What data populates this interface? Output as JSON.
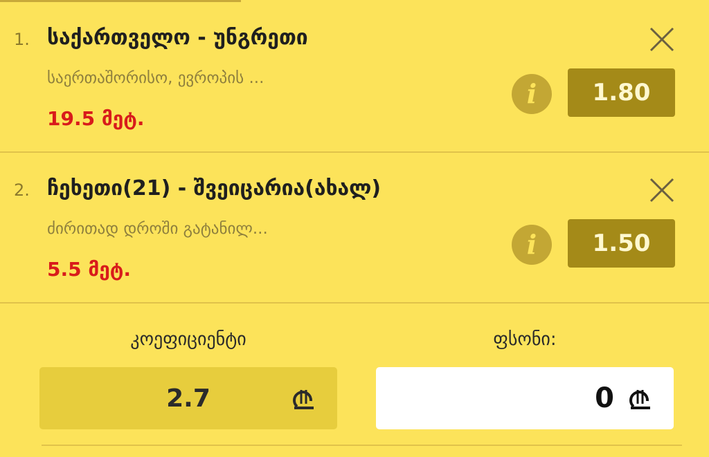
{
  "bets": [
    {
      "index": "1.",
      "title": "საქართველო - უნგრეთი",
      "subtitle": "საერთაშორისო, ევროპის ...",
      "stake": "19.5 მეტ.",
      "odds": "1.80"
    },
    {
      "index": "2.",
      "title": "ჩეხეთი(21) - შვეიცარია(ახალ)",
      "subtitle": "ძირითად დროში გატანილ...",
      "stake": "5.5 მეტ.",
      "odds": "1.50"
    }
  ],
  "summary": {
    "coefficient_label": "კოეფიციენტი",
    "coefficient_value": "2.7",
    "stake_label": "ფსონი:",
    "stake_value": "0"
  },
  "icons": {
    "close": "close-icon",
    "info": "info-icon",
    "currency": "lari-icon"
  },
  "colors": {
    "background": "#fce35a",
    "odds_button": "#a48a18",
    "stake_red": "#d81b1b",
    "info_circle": "#c3a734"
  }
}
